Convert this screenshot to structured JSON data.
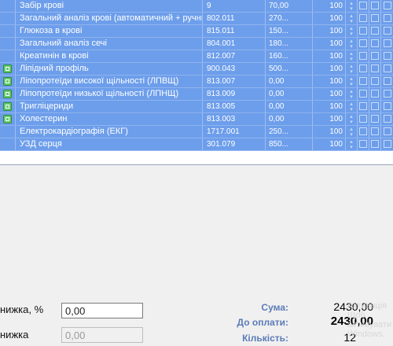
{
  "services": [
    {
      "name": "Забір крові",
      "code": "9",
      "price": "70,00",
      "qty": "100",
      "checked": false
    },
    {
      "name": "Загальний аналіз крові (автоматичний + ручний ...",
      "code": "802.011",
      "price": "270...",
      "qty": "100",
      "checked": false
    },
    {
      "name": "Глюкоза в крові",
      "code": "815.011",
      "price": "150...",
      "qty": "100",
      "checked": false
    },
    {
      "name": "Загальний аналіз сечі",
      "code": "804.001",
      "price": "180...",
      "qty": "100",
      "checked": false
    },
    {
      "name": "Креатинін в крові",
      "code": "812.007",
      "price": "160...",
      "qty": "100",
      "checked": false
    },
    {
      "name": "Ліпідний профіль",
      "code": "900.043",
      "price": "500...",
      "qty": "100",
      "checked": true
    },
    {
      "name": "Ліпопротеїди високої щільності (ЛПВЩ)",
      "code": "813.007",
      "price": "0,00",
      "qty": "100",
      "checked": true
    },
    {
      "name": "Ліпопротеїди низької щільності (ЛПНЩ)",
      "code": "813.009",
      "price": "0,00",
      "qty": "100",
      "checked": true
    },
    {
      "name": "Тригліцериди",
      "code": "813.005",
      "price": "0,00",
      "qty": "100",
      "checked": true
    },
    {
      "name": "Холестерин",
      "code": "813.003",
      "price": "0,00",
      "qty": "100",
      "checked": true
    },
    {
      "name": "Електрокардіографія (ЕКГ)",
      "code": "1717.001",
      "price": "250...",
      "qty": "100",
      "checked": false
    },
    {
      "name": "УЗД серця",
      "code": "301.079",
      "price": "850...",
      "qty": "100",
      "checked": false
    }
  ],
  "form": {
    "discount_pct_label": "нижка, %",
    "discount_pct_value": "0,00",
    "discount_label": "нижка",
    "discount_value": "0,00"
  },
  "summary": {
    "sum_label": "Сума:",
    "sum_value": "2430,00",
    "pay_label": "До оплати:",
    "pay_value": "2430,00",
    "count_label": "Кількість:",
    "count_value": "12"
  },
  "watermark": {
    "line1": "Активація",
    "line2": "Щоб активувати",
    "line3": "Windows."
  },
  "colors": {
    "row_selected": "#6d9eeb",
    "summary_label": "#5b7bb8",
    "checkbox_green": "#63c96d"
  },
  "icons": {
    "row_status": "green-check-icon",
    "spin": "spin-arrows-icon"
  }
}
